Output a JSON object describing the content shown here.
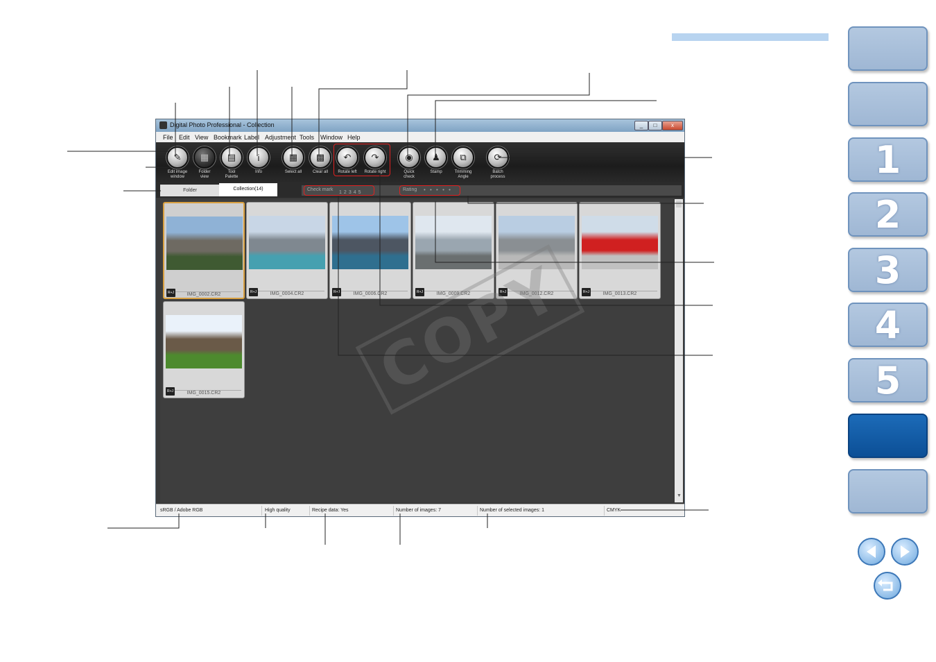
{
  "window": {
    "title": "Digital Photo Professional - Collection",
    "controls": [
      "_",
      "□",
      "x"
    ]
  },
  "menu": [
    "File",
    "Edit",
    "View",
    "Bookmark",
    "Label",
    "Adjustment",
    "Tools",
    "Window",
    "Help"
  ],
  "toolbar": [
    {
      "label": "Edit image\nwindow",
      "icon": "edit-image-icon",
      "glyph": "✎"
    },
    {
      "label": "Folder\nview",
      "icon": "folder-view-icon",
      "glyph": "▦"
    },
    {
      "label": "Tool\nPalette",
      "icon": "tool-palette-icon",
      "glyph": "▤"
    },
    {
      "label": "Info",
      "icon": "info-icon",
      "glyph": "i"
    },
    {
      "label": "Select all",
      "icon": "select-all-icon",
      "glyph": "▦"
    },
    {
      "label": "Clear all",
      "icon": "clear-all-icon",
      "glyph": "▩"
    },
    {
      "label": "Rotate left",
      "icon": "rotate-left-icon",
      "glyph": "↶"
    },
    {
      "label": "Rotate right",
      "icon": "rotate-right-icon",
      "glyph": "↷"
    },
    {
      "label": "Quick\ncheck",
      "icon": "quick-check-icon",
      "glyph": "◉"
    },
    {
      "label": "Stamp",
      "icon": "stamp-icon",
      "glyph": "♟"
    },
    {
      "label": "Trimming\nAngle",
      "icon": "trimming-angle-icon",
      "glyph": "⧉"
    },
    {
      "label": "Batch\nprocess",
      "icon": "batch-process-icon",
      "glyph": "⟳"
    }
  ],
  "tabs": {
    "folder": "Folder",
    "collection": "Collection(14)"
  },
  "filter": {
    "check_mark_label": "Check mark",
    "check_marks": [
      "1",
      "2",
      "3",
      "4",
      "5"
    ],
    "rating_label": "Rating",
    "rating_stars": "• • • • •"
  },
  "thumbnails": [
    {
      "file": "IMG_0002.CR2",
      "badge": "R+J",
      "selected": true
    },
    {
      "file": "IMG_0004.CR2",
      "badge": "R+J",
      "selected": false
    },
    {
      "file": "IMG_0006.CR2",
      "badge": "R+J",
      "selected": false
    },
    {
      "file": "IMG_0009.CR2",
      "badge": "R+J",
      "selected": false
    },
    {
      "file": "IMG_0012.CR2",
      "badge": "R+J",
      "selected": false
    },
    {
      "file": "IMG_0013.CR2",
      "badge": "R+J",
      "selected": false
    },
    {
      "file": "IMG_0015.CR2",
      "badge": "R+J",
      "selected": false
    }
  ],
  "status": {
    "color_space": "sRGB / Adobe RGB",
    "quality": "High quality",
    "recipe": "Recipe data: Yes",
    "count": "Number of images: 7",
    "selected": "Number of selected images: 1",
    "cmyk": "CMYK"
  },
  "nav_tabs": [
    {
      "label": "",
      "active": false
    },
    {
      "label": "",
      "active": false
    },
    {
      "label": "1",
      "active": false
    },
    {
      "label": "2",
      "active": false
    },
    {
      "label": "3",
      "active": false
    },
    {
      "label": "4",
      "active": false
    },
    {
      "label": "5",
      "active": false
    },
    {
      "label": "",
      "active": true
    },
    {
      "label": "",
      "active": false
    }
  ],
  "watermark": "COPY",
  "colors": {
    "accent_bar": "#b8d4f0",
    "nav_tab": "#a9c0db",
    "nav_tab_active": "#1560ad",
    "highlight_box": "#e02020"
  }
}
